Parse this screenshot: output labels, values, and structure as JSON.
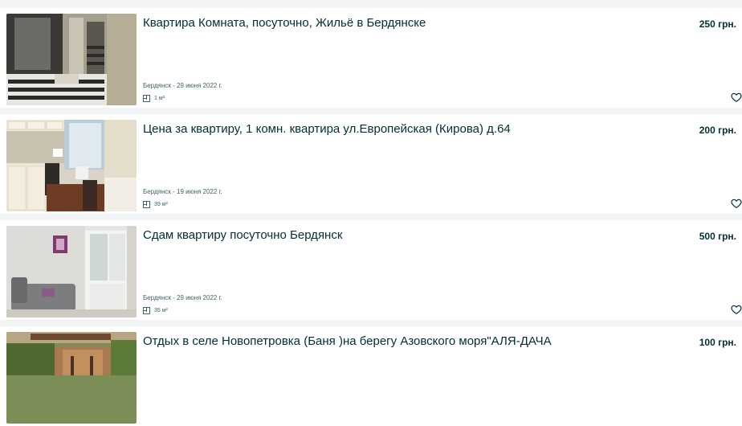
{
  "listings": [
    {
      "title": "Квартира Комната, посуточно, Жильё в Бердянске",
      "price": "250 грн.",
      "meta": "Бердянск - 29 июня 2022 г.",
      "area": "1 м²"
    },
    {
      "title": "Цена за квартиру, 1 комн. квартира ул.Европейская (Кирова) д.64",
      "price": "200 грн.",
      "meta": "Бердянск - 19 июня 2022 г.",
      "area": "39 м²"
    },
    {
      "title": "Сдам квартиру посуточно Бердянск",
      "price": "500 грн.",
      "meta": "Бердянск - 29 июня 2022 г.",
      "area": "35 м²"
    },
    {
      "title": "Отдых в селе Новопетровка (Баня )на берегу Азовского моря\"АЛЯ-ДАЧА",
      "price": "100 грн.",
      "meta": "",
      "area": ""
    }
  ],
  "icons": {
    "area": "floor-plan-icon",
    "favorite": "heart-outline-icon"
  },
  "colors": {
    "page_bg": "#f2f4f5",
    "card_bg": "#ffffff",
    "text": "#002f34",
    "muted": "#406367"
  }
}
